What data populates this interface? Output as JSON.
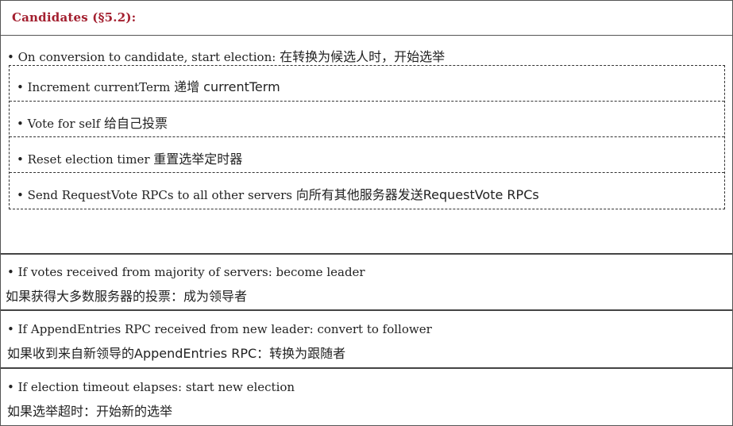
{
  "header": {
    "title": "Candidates (§5.2):"
  },
  "conversion": {
    "text": "• On conversion to candidate, start election: ",
    "zh": "在转换为候选人时，开始选举"
  },
  "steps": [
    {
      "en": "• Increment currentTerm ",
      "zh": "递增 currentTerm"
    },
    {
      "en": "• Vote for self ",
      "zh": "给自己投票"
    },
    {
      "en": "• Reset election timer ",
      "zh": "重置选举定时器"
    },
    {
      "en": "• Send RequestVote RPCs to all other servers ",
      "zh": "向所有其他服务器发送RequestVote RPCs"
    }
  ],
  "rules": [
    {
      "en": "• If votes received from majority of servers: become leader",
      "zh": " 如果获得大多数服务器的投票：成为领导者"
    },
    {
      "en": "• If AppendEntries RPC received from new leader: convert to follower",
      "zh": "如果收到来自新领导的AppendEntries RPC：转换为跟随者"
    },
    {
      "en": "• If election timeout elapses: start new election",
      "zh": "如果选举超时：开始新的选举"
    }
  ]
}
